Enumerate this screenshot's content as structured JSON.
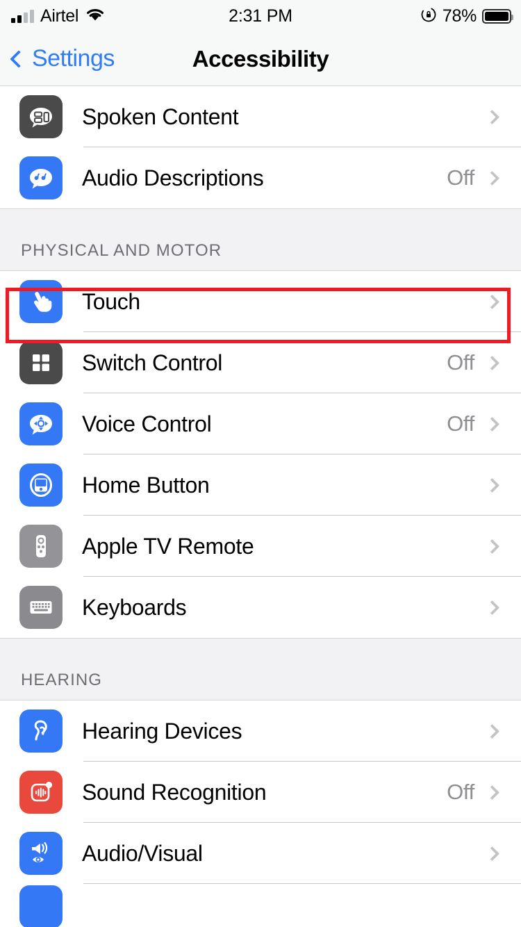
{
  "status_bar": {
    "carrier": "Airtel",
    "time": "2:31 PM",
    "battery_percent": "78%",
    "signal_icon": "cellular-signal-icon",
    "wifi_icon": "wifi-icon",
    "rotation_lock_icon": "rotation-lock-icon",
    "battery_icon": "battery-icon"
  },
  "nav": {
    "back_label": "Settings",
    "title": "Accessibility",
    "back_icon": "chevron-left-icon",
    "accent_color": "#2f7cf6"
  },
  "groups": [
    {
      "header": null,
      "rows": [
        {
          "label": "Spoken Content",
          "value": "",
          "icon": "spoken-content-icon",
          "icon_color": "#4a4a4a"
        },
        {
          "label": "Audio Descriptions",
          "value": "Off",
          "icon": "audio-descriptions-icon",
          "icon_color": "#3478f6"
        }
      ]
    },
    {
      "header": "PHYSICAL AND MOTOR",
      "rows": [
        {
          "label": "Touch",
          "value": "",
          "icon": "touch-icon",
          "icon_color": "#3478f6",
          "highlighted": true
        },
        {
          "label": "Switch Control",
          "value": "Off",
          "icon": "switch-control-icon",
          "icon_color": "#4a4a4a"
        },
        {
          "label": "Voice Control",
          "value": "Off",
          "icon": "voice-control-icon",
          "icon_color": "#3478f6"
        },
        {
          "label": "Home Button",
          "value": "",
          "icon": "home-button-icon",
          "icon_color": "#3478f6"
        },
        {
          "label": "Apple TV Remote",
          "value": "",
          "icon": "apple-tv-remote-icon",
          "icon_color": "#939398"
        },
        {
          "label": "Keyboards",
          "value": "",
          "icon": "keyboards-icon",
          "icon_color": "#8a8a8f"
        }
      ]
    },
    {
      "header": "HEARING",
      "rows": [
        {
          "label": "Hearing Devices",
          "value": "",
          "icon": "hearing-devices-icon",
          "icon_color": "#3478f6"
        },
        {
          "label": "Sound Recognition",
          "value": "Off",
          "icon": "sound-recognition-icon",
          "icon_color": "#e9493d"
        },
        {
          "label": "Audio/Visual",
          "value": "",
          "icon": "audio-visual-icon",
          "icon_color": "#3478f6"
        }
      ]
    }
  ],
  "annotation": {
    "target_row": "Touch",
    "color": "#ee1b24"
  }
}
